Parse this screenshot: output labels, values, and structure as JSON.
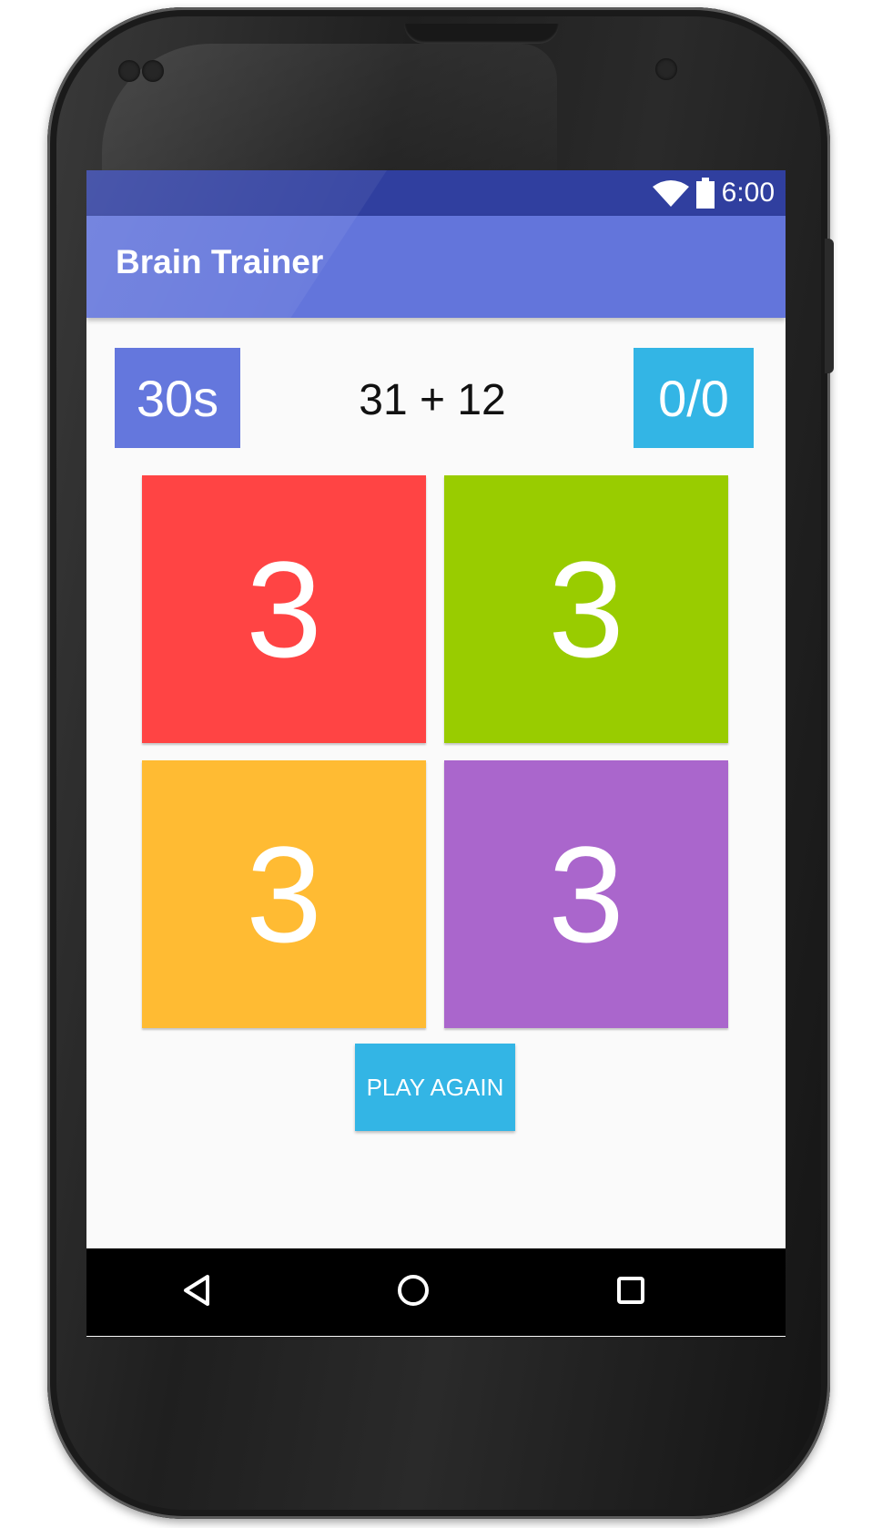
{
  "status_bar": {
    "time": "6:00",
    "icons": [
      "wifi-icon",
      "battery-icon"
    ]
  },
  "app_bar": {
    "title": "Brain Trainer"
  },
  "game": {
    "timer": "30s",
    "question": "31 + 12",
    "score": "0/0",
    "answers": [
      "3",
      "3",
      "3",
      "3"
    ],
    "play_again_label": "PLAY AGAIN"
  },
  "nav_bar": {
    "icons": [
      "back-icon",
      "home-icon",
      "recents-icon"
    ]
  },
  "colors": {
    "status_bar": "#303f9f",
    "app_bar": "#6375db",
    "timer_bg": "#6477dd",
    "score_bg": "#33b5e5",
    "answer_1": "#ff4444",
    "answer_2": "#99cc00",
    "answer_3": "#ffbb33",
    "answer_4": "#aa66cc",
    "play_again_bg": "#33b5e5"
  }
}
